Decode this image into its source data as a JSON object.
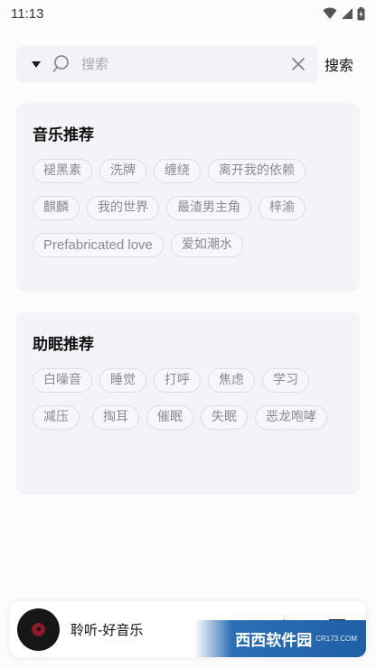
{
  "status_bar": {
    "time": "11:13"
  },
  "search": {
    "placeholder": "搜索",
    "button_label": "搜索"
  },
  "music_section": {
    "title": "音乐推荐",
    "tags": [
      "褪黑素",
      "洗牌",
      "缠绕",
      "离开我的依赖",
      "麒麟",
      "我的世界",
      "最渣男主角",
      "梓渝",
      "Prefabricated love",
      "爱如潮水"
    ]
  },
  "sleep_section": {
    "title": "助眠推荐",
    "tags": [
      "白噪音",
      "睡觉",
      "打呼",
      "焦虑",
      "学习",
      "减压",
      "掏耳",
      "催眠",
      "失眠",
      "恶龙咆哮"
    ]
  },
  "player": {
    "title": "聆听-好音乐"
  },
  "watermark": {
    "logo": "西西软件园",
    "sub": "CR173.COM"
  },
  "colors": {
    "card_bg": "#f3f4f8",
    "search_bg": "#f2f3f6",
    "tag_text": "#888a90",
    "disc_label": "#8b1a2a"
  }
}
